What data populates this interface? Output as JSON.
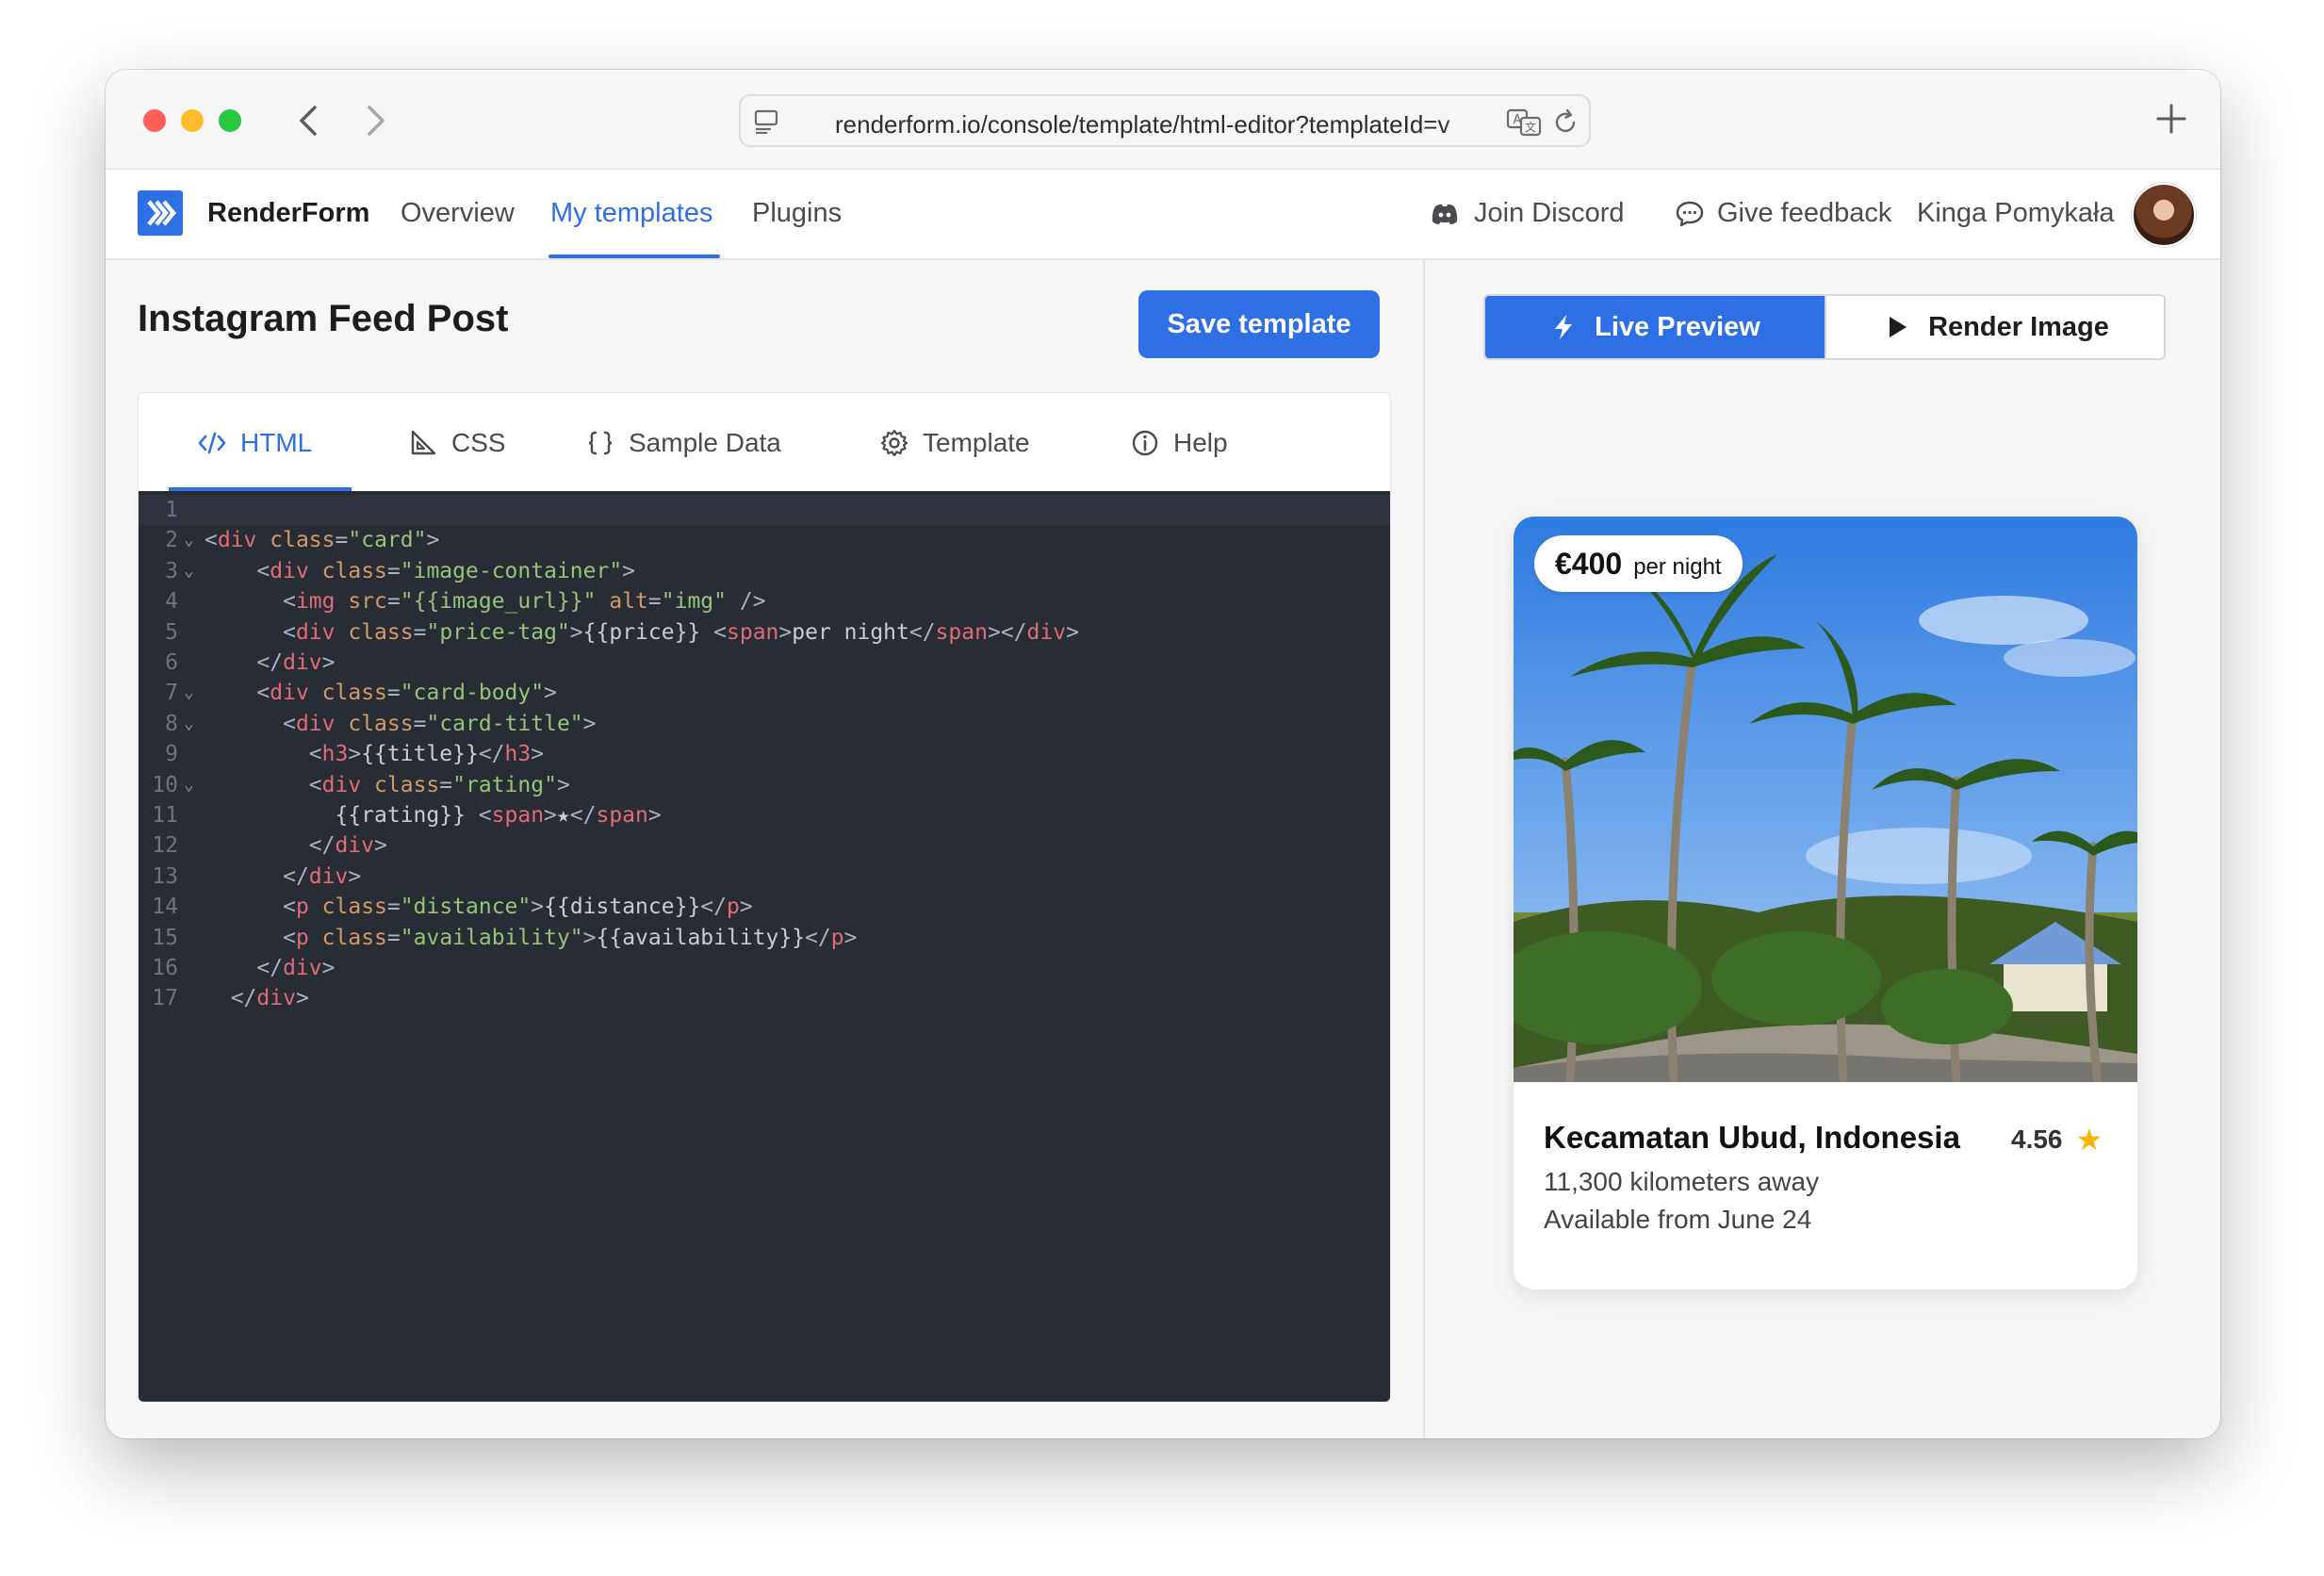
{
  "browser": {
    "url": "renderform.io/console/template/html-editor?templateId=v"
  },
  "header": {
    "brand": "RenderForm",
    "nav": [
      "Overview",
      "My templates",
      "Plugins"
    ],
    "active_nav": "My templates",
    "join_discord": "Join Discord",
    "give_feedback": "Give feedback",
    "user_name": "Kinga Pomykała"
  },
  "editor": {
    "page_title": "Instagram Feed Post",
    "save_label": "Save template",
    "tabs": [
      {
        "label": "HTML",
        "icon": "code-icon"
      },
      {
        "label": "CSS",
        "icon": "set-square-icon"
      },
      {
        "label": "Sample Data",
        "icon": "braces-icon"
      },
      {
        "label": "Template",
        "icon": "gear-icon"
      },
      {
        "label": "Help",
        "icon": "info-icon"
      }
    ],
    "active_tab": "HTML",
    "code_lines": [
      "",
      "<div class=\"card\">",
      "    <div class=\"image-container\">",
      "      <img src=\"{{image_url}}\" alt=\"img\" />",
      "      <div class=\"price-tag\">{{price}} <span>per night</span></div>",
      "    </div>",
      "    <div class=\"card-body\">",
      "      <div class=\"card-title\">",
      "        <h3>{{title}}</h3>",
      "        <div class=\"rating\">",
      "          {{rating}} <span>★</span>",
      "        </div>",
      "      </div>",
      "      <p class=\"distance\">{{distance}}</p>",
      "      <p class=\"availability\">{{availability}}</p>",
      "    </div>",
      "  </div>"
    ],
    "foldable_lines": [
      2,
      3,
      7,
      8,
      10
    ]
  },
  "preview": {
    "live_label": "Live Preview",
    "render_label": "Render Image",
    "card": {
      "price": "€400",
      "price_unit": "per night",
      "title": "Kecamatan Ubud, Indonesia",
      "rating": "4.56",
      "distance": "11,300 kilometers away",
      "availability": "Available from June 24"
    }
  },
  "colors": {
    "accent": "#2f6fe4",
    "code_bg": "#282c34",
    "star": "#f4b400"
  }
}
